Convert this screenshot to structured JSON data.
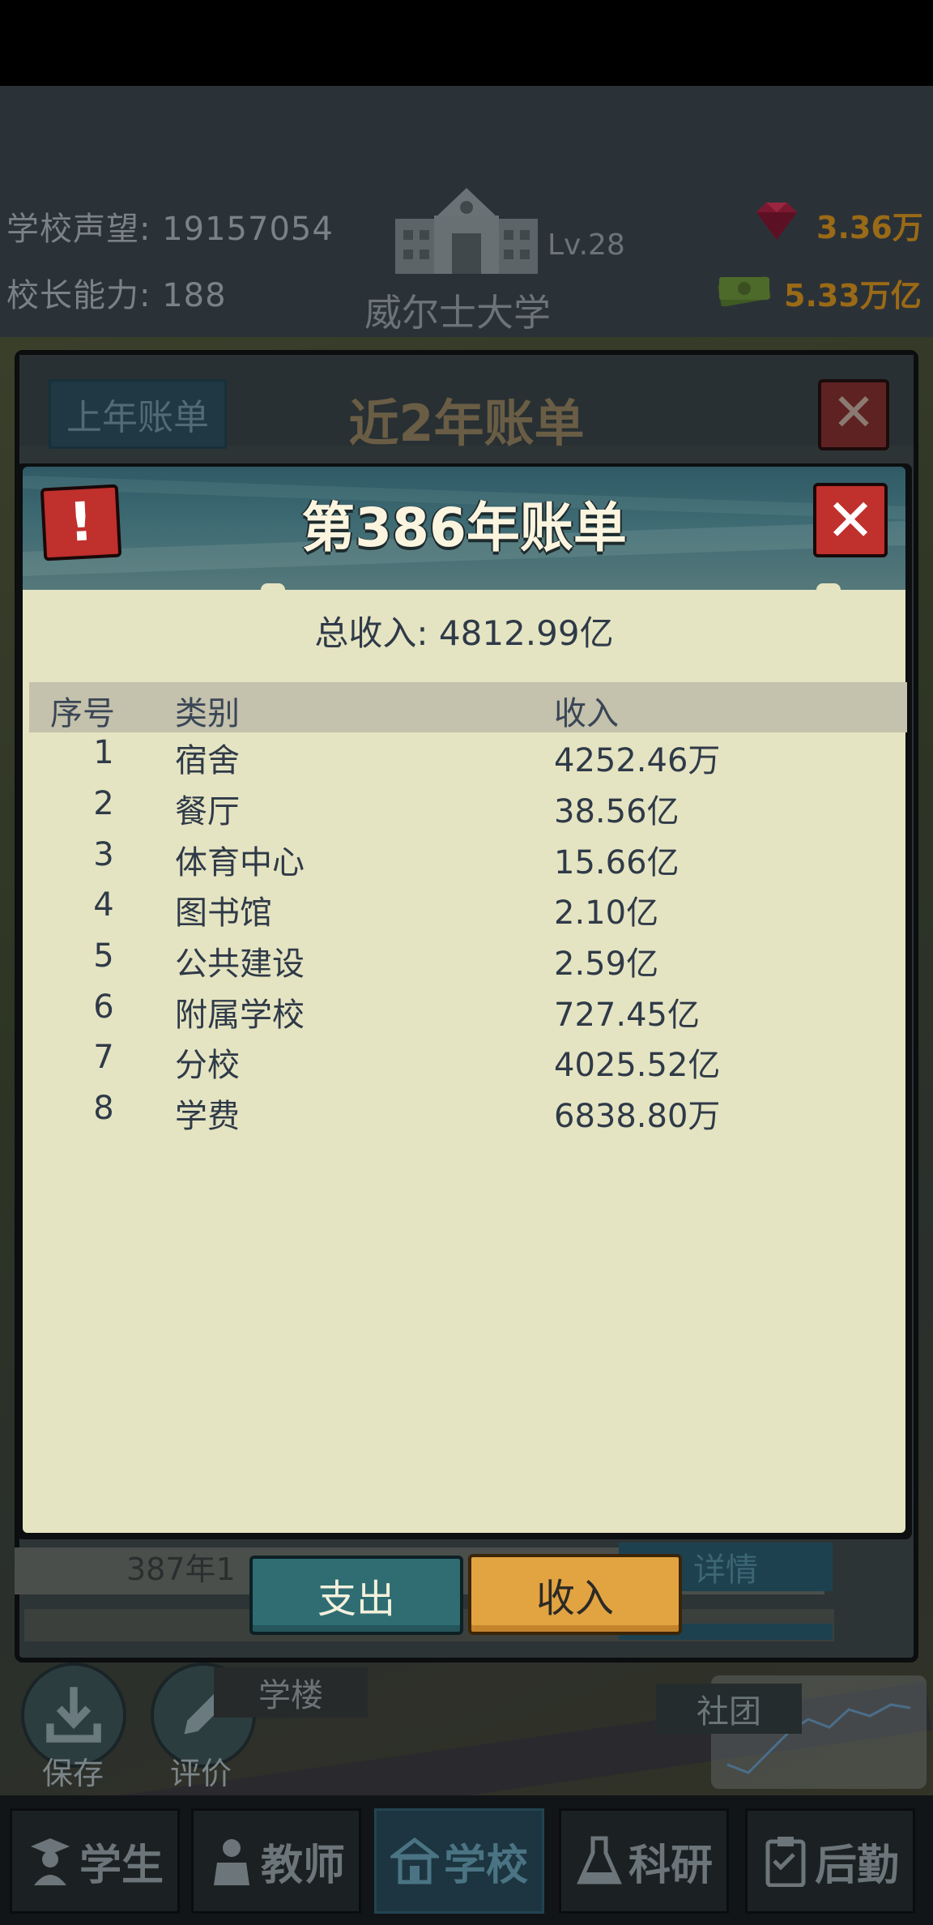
{
  "header": {
    "reputation_label": "学校声望:",
    "reputation_value": "19157054",
    "principal_label": "校长能力:",
    "principal_value": "188",
    "school_level": "Lv.28",
    "school_name": "威尔士大学",
    "gems": "3.36万",
    "cash": "5.33万亿"
  },
  "back_panel": {
    "tab_label": "上年账单",
    "title": "近2年账单",
    "close": "✕",
    "row_text": "387年1",
    "detail_label": "详情"
  },
  "dialog": {
    "title": "第386年账单",
    "alert": "!",
    "close": "✕",
    "total_label": "总收入:",
    "total_value": "4812.99亿",
    "columns": [
      "序号",
      "类别",
      "收入"
    ],
    "rows": [
      {
        "no": "1",
        "category": "宿舍",
        "income": "4252.46万"
      },
      {
        "no": "2",
        "category": "餐厅",
        "income": "38.56亿"
      },
      {
        "no": "3",
        "category": "体育中心",
        "income": "15.66亿"
      },
      {
        "no": "4",
        "category": "图书馆",
        "income": "2.10亿"
      },
      {
        "no": "5",
        "category": "公共建设",
        "income": "2.59亿"
      },
      {
        "no": "6",
        "category": "附属学校",
        "income": "727.45亿"
      },
      {
        "no": "7",
        "category": "分校",
        "income": "4025.52亿"
      },
      {
        "no": "8",
        "category": "学费",
        "income": "6838.80万"
      }
    ]
  },
  "tabs": {
    "expense": "支出",
    "income": "收入"
  },
  "quick": {
    "save": "保存",
    "rate": "评价",
    "building": "学楼",
    "club": "社团"
  },
  "nav": [
    {
      "label": "学生",
      "icon": "student-icon"
    },
    {
      "label": "教师",
      "icon": "teacher-icon"
    },
    {
      "label": "学校",
      "icon": "school-icon"
    },
    {
      "label": "科研",
      "icon": "flask-icon"
    },
    {
      "label": "后勤",
      "icon": "clipboard-icon"
    }
  ],
  "colors": {
    "accent_income": "#e2a341",
    "accent_expense": "#2f6d73",
    "close_red": "#c0302c",
    "paper": "#e5e4c2"
  }
}
